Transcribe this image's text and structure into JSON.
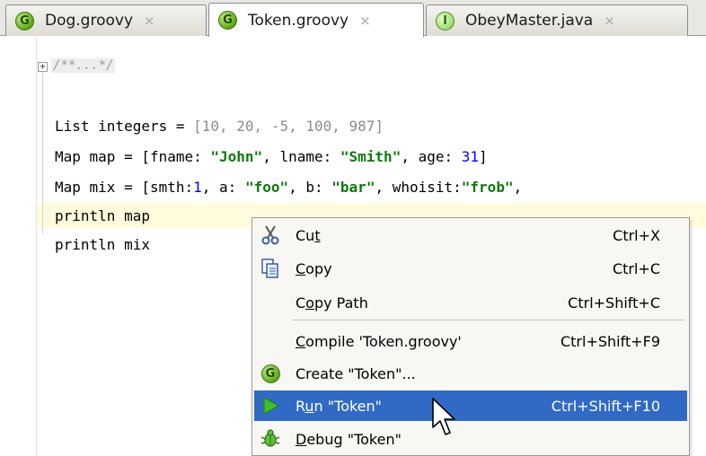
{
  "tabs": [
    {
      "label": "Dog.groovy",
      "icon": "groovy-class-icon",
      "badge": "G",
      "close": "×"
    },
    {
      "label": "Token.groovy",
      "icon": "groovy-class-icon",
      "badge": "G",
      "close": "×"
    },
    {
      "label": "ObeyMaster.java",
      "icon": "java-interface-icon",
      "badge": "I",
      "close": "×"
    }
  ],
  "editor": {
    "fold_marker": "+",
    "collapsed_comment": "/**...*/",
    "lines": [
      "List integers = [10, 20, -5, 100, 987]",
      "Map map = [fname: \"John\", lname: \"Smith\", age: 31]",
      "Map mix = [smth:1, a: \"foo\", b: \"bar\", whoisit:\"frob\",",
      "println map",
      "println mix"
    ],
    "tokens": {
      "l1_a": "List integers = ",
      "l1_b": "[10, 20, -5, 100, 987]",
      "l2_a": "Map map = [fname: ",
      "l2_b": "\"John\"",
      "l2_c": ", lname: ",
      "l2_d": "\"Smith\"",
      "l2_e": ", age: ",
      "l2_f": "31",
      "l2_g": "]",
      "l3_a": "Map mix = [smth:",
      "l3_b": "1",
      "l3_c": ", a: ",
      "l3_d": "\"foo\"",
      "l3_e": ", b: ",
      "l3_f": "\"bar\"",
      "l3_g": ", whoisit:",
      "l3_h": "\"frob\"",
      "l3_i": ",",
      "l4": "println map",
      "l5": "println mix"
    }
  },
  "context_menu": {
    "items": [
      {
        "pre": "Cu",
        "mnemonic": "t",
        "post": "",
        "shortcut": "Ctrl+X",
        "icon": "scissors-icon"
      },
      {
        "pre": "",
        "mnemonic": "C",
        "post": "opy",
        "shortcut": "Ctrl+C",
        "icon": "copy-icon"
      },
      {
        "pre": "C",
        "mnemonic": "o",
        "post": "py Path",
        "shortcut": "Ctrl+Shift+C",
        "icon": ""
      },
      {
        "pre": "",
        "mnemonic": "C",
        "post": "ompile 'Token.groovy'",
        "shortcut": "Ctrl+Shift+F9",
        "icon": ""
      },
      {
        "pre": "Create \"Token\"...",
        "mnemonic": "",
        "post": "",
        "shortcut": "",
        "icon": "groovy-class-icon"
      },
      {
        "pre": "R",
        "mnemonic": "u",
        "post": "n \"Token\"",
        "shortcut": "Ctrl+Shift+F10",
        "icon": "run-icon",
        "selected": true
      },
      {
        "pre": "",
        "mnemonic": "D",
        "post": "ebug \"Token\"",
        "shortcut": "",
        "icon": "debug-icon"
      }
    ]
  },
  "colors": {
    "selection": "#316ac5",
    "string": "#0c7a0c",
    "number": "#0000ff",
    "current_line": "#fffbdc"
  }
}
